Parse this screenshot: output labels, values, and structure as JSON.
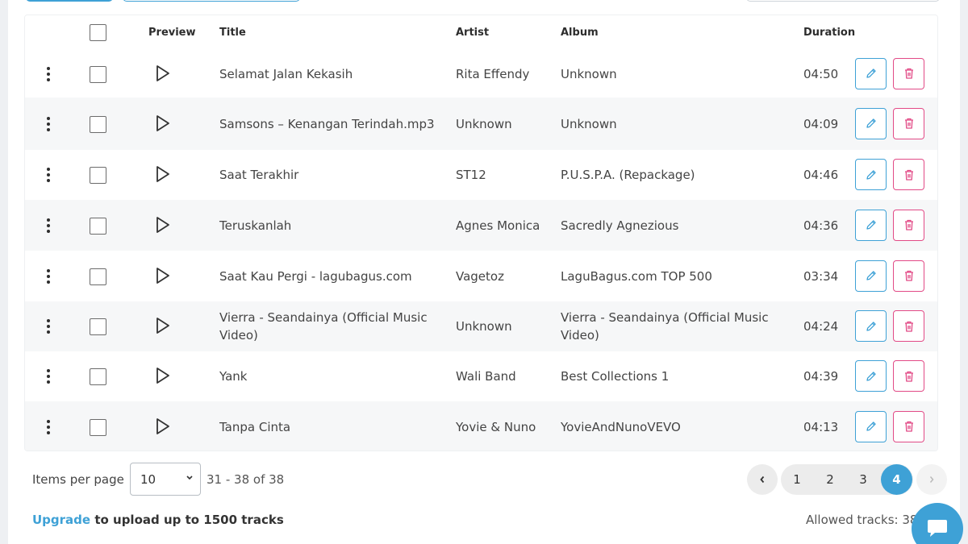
{
  "table": {
    "headers": {
      "preview": "Preview",
      "title": "Title",
      "artist": "Artist",
      "album": "Album",
      "duration": "Duration"
    },
    "rows": [
      {
        "title": "Selamat Jalan Kekasih",
        "artist": "Rita Effendy",
        "album": "Unknown",
        "duration": "04:50"
      },
      {
        "title": "Samsons – Kenangan Terindah.mp3",
        "artist": "Unknown",
        "album": "Unknown",
        "duration": "04:09"
      },
      {
        "title": "Saat Terakhir",
        "artist": "ST12",
        "album": "P.U.S.P.A. (Repackage)",
        "duration": "04:46"
      },
      {
        "title": "Teruskanlah",
        "artist": "Agnes Monica",
        "album": "Sacredly Agnezious",
        "duration": "04:36"
      },
      {
        "title": "Saat Kau Pergi - lagubagus.com",
        "artist": "Vagetoz",
        "album": "LaguBagus.com TOP 500",
        "duration": "03:34"
      },
      {
        "title": "Vierra - Seandainya (Official Music Video)",
        "artist": "Unknown",
        "album": "Vierra - Seandainya (Official Music Video)",
        "duration": "04:24"
      },
      {
        "title": "Yank",
        "artist": "Wali Band",
        "album": "Best Collections 1",
        "duration": "04:39"
      },
      {
        "title": "Tanpa Cinta",
        "artist": "Yovie & Nuno",
        "album": "YovieAndNunoVEVO",
        "duration": "04:13"
      }
    ]
  },
  "footer": {
    "items_per_page_label": "Items per page",
    "items_per_page_value": "10",
    "range_text": "31 - 38 of 38",
    "pages": [
      "1",
      "2",
      "3"
    ],
    "active_page": "4",
    "upgrade_link": "Upgrade",
    "upgrade_text": " to upload up to 1500 tracks",
    "allowed_tracks": "Allowed tracks: 38 /"
  },
  "icons": {
    "row_menu": "kebab-menu-icon",
    "play": "play-icon",
    "edit": "pencil-icon",
    "delete": "trash-icon",
    "prev": "chevron-left-icon",
    "next": "chevron-right-icon",
    "chat": "chat-bubble-icon"
  },
  "colors": {
    "accent": "#3ea1d6",
    "delete": "#e24a86",
    "row_alt": "#f6f7f8"
  }
}
